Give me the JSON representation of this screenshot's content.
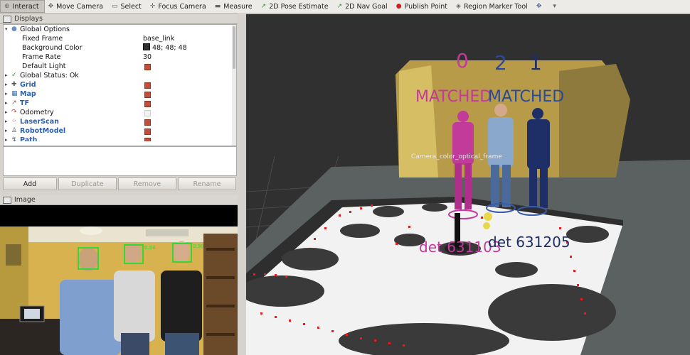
{
  "toolbar": {
    "tools": [
      {
        "label": "Interact",
        "icon": "interact-icon",
        "glyph": "⊕",
        "active": true
      },
      {
        "label": "Move Camera",
        "icon": "move-camera-icon",
        "glyph": "✥"
      },
      {
        "label": "Select",
        "icon": "select-icon",
        "glyph": "▭"
      },
      {
        "label": "Focus Camera",
        "icon": "focus-camera-icon",
        "glyph": "✛"
      },
      {
        "label": "Measure",
        "icon": "measure-icon",
        "glyph": "▬"
      },
      {
        "label": "2D Pose Estimate",
        "icon": "pose-estimate-icon",
        "glyph": "↗"
      },
      {
        "label": "2D Nav Goal",
        "icon": "nav-goal-icon",
        "glyph": "↗"
      },
      {
        "label": "Publish Point",
        "icon": "publish-point-icon",
        "glyph": "●"
      },
      {
        "label": "Region Marker Tool",
        "icon": "region-marker-icon",
        "glyph": "◈"
      }
    ],
    "add_tool": "✥",
    "dropdown": "▾"
  },
  "displays_panel": {
    "title": "Displays",
    "items": [
      {
        "name": "Global Options",
        "expanded": true,
        "level": 0,
        "icon": "globe-icon"
      },
      {
        "name": "Fixed Frame",
        "value": "base_link",
        "level": 1
      },
      {
        "name": "Background Color",
        "value": "48; 48; 48",
        "level": 1,
        "swatch": "#303030"
      },
      {
        "name": "Frame Rate",
        "value": "30",
        "level": 1
      },
      {
        "name": "Default Light",
        "level": 1,
        "checked": true
      },
      {
        "name": "Global Status: Ok",
        "level": 0,
        "icon": "check-icon"
      },
      {
        "name": "Grid",
        "level": 0,
        "icon": "grid-icon",
        "checked": true,
        "blue": true
      },
      {
        "name": "Map",
        "level": 0,
        "icon": "map-icon",
        "checked": true,
        "blue": true
      },
      {
        "name": "TF",
        "level": 0,
        "icon": "tf-icon",
        "checked": true,
        "blue": true
      },
      {
        "name": "Odometry",
        "level": 0,
        "icon": "odometry-icon",
        "checked": false
      },
      {
        "name": "LaserScan",
        "level": 0,
        "icon": "laserscan-icon",
        "checked": true,
        "blue": true
      },
      {
        "name": "RobotModel",
        "level": 0,
        "icon": "robotmodel-icon",
        "checked": true,
        "blue": true
      },
      {
        "name": "Path",
        "level": 0,
        "icon": "path-icon",
        "checked": true,
        "blue": true
      }
    ],
    "buttons": {
      "add": "Add",
      "duplicate": "Duplicate",
      "remove": "Remove",
      "rename": "Rename"
    }
  },
  "image_panel": {
    "title": "Image",
    "detections": [
      "0.94",
      "0.90"
    ]
  },
  "view3d": {
    "ids": [
      "0",
      "2",
      "1"
    ],
    "matched_labels": [
      "MATCHED",
      "MATCHED"
    ],
    "frame_label": "Camera_color_optical_frame",
    "det_labels": [
      "det 631103",
      "det 631205"
    ],
    "colors": {
      "magenta": "#c23a9a",
      "navy": "#1e2e66",
      "blue": "#2a4a9a"
    }
  }
}
